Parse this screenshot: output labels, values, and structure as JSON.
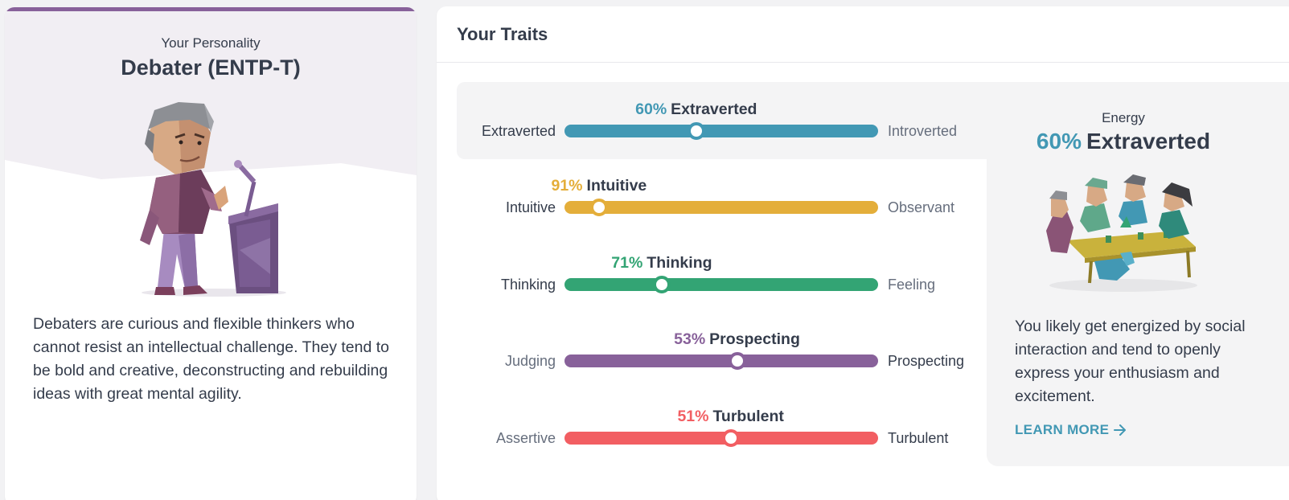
{
  "personality": {
    "label": "Your Personality",
    "name": "Debater (ENTP-T)",
    "description": "Debaters are curious and flexible thinkers who cannot resist an intellectual challenge. They tend to be bold and creative, deconstructing and rebuilding ideas with great mental agility.",
    "accent_color": "#88619a"
  },
  "traits_section": {
    "title": "Your Traits",
    "traits": [
      {
        "percent_label": "60%",
        "name": "Extraverted",
        "left": "Extraverted",
        "right": "Introverted",
        "position_percent": 42,
        "color": "#4298b4",
        "dominant_side": "left"
      },
      {
        "percent_label": "91%",
        "name": "Intuitive",
        "left": "Intuitive",
        "right": "Observant",
        "position_percent": 11,
        "color": "#e4ae3a",
        "dominant_side": "left"
      },
      {
        "percent_label": "71%",
        "name": "Thinking",
        "left": "Thinking",
        "right": "Feeling",
        "position_percent": 31,
        "color": "#33a474",
        "dominant_side": "left"
      },
      {
        "percent_label": "53%",
        "name": "Prospecting",
        "left": "Judging",
        "right": "Prospecting",
        "position_percent": 55,
        "color": "#88619a",
        "dominant_side": "right"
      },
      {
        "percent_label": "51%",
        "name": "Turbulent",
        "left": "Assertive",
        "right": "Turbulent",
        "position_percent": 53,
        "color": "#f25e62",
        "dominant_side": "right"
      }
    ]
  },
  "energy": {
    "label": "Energy",
    "percent_label": "60%",
    "name": "Extraverted",
    "description": "You likely get energized by social interaction and tend to openly express your enthusiasm and excitement.",
    "learn_more": "LEARN MORE",
    "learn_more_icon": "arrow-right-icon"
  }
}
